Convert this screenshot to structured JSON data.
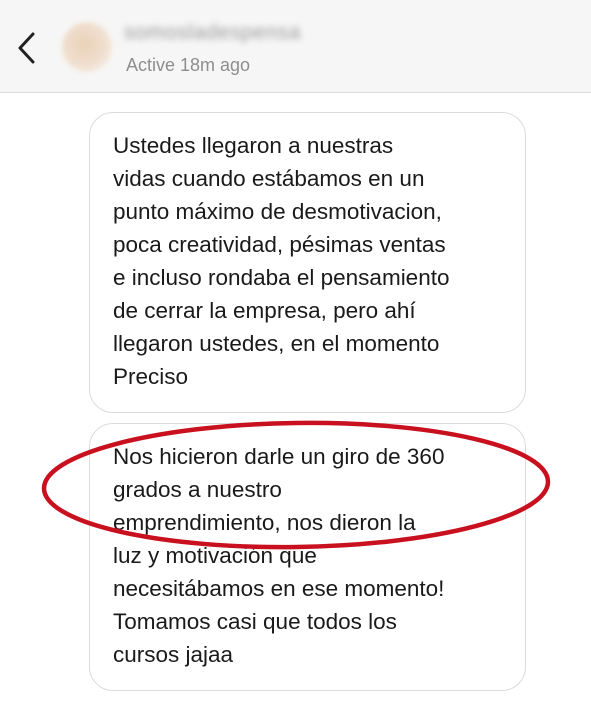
{
  "header": {
    "username": "somosladespensa",
    "status": "Active 18m ago",
    "back_icon": "chevron-left-icon"
  },
  "messages": [
    {
      "text": "Ustedes llegaron a nuestras\nvidas cuando estábamos en un\npunto máximo de desmotivacion,\npoca creatividad, pésimas ventas\ne incluso rondaba el pensamiento\nde cerrar la empresa, pero ahí\nllegaron ustedes, en el momento\nPreciso"
    },
    {
      "text": "Nos hicieron darle un giro de 360\ngrados a nuestro\nemprendimiento, nos dieron la\nluz y motivación que\nnecesitábamos en ese momento!\nTomamos casi que todos los\ncursos jajaa"
    }
  ],
  "colors": {
    "header_bg": "#f6f6f6",
    "bubble_border": "#dbdbdb",
    "highlight": "#c8101e",
    "status_text": "#8e8e8e"
  }
}
